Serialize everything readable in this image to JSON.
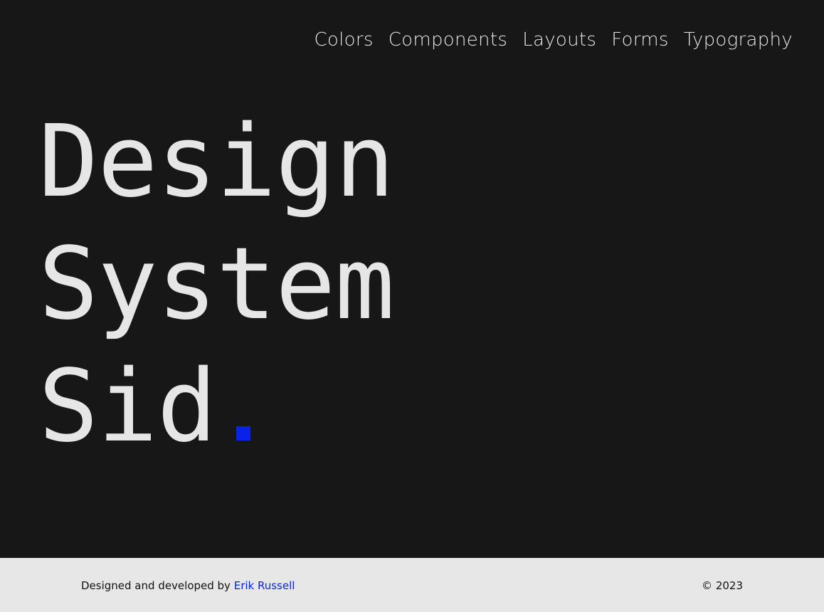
{
  "nav": {
    "items": [
      {
        "label": "Colors"
      },
      {
        "label": "Components"
      },
      {
        "label": "Layouts"
      },
      {
        "label": "Forms"
      },
      {
        "label": "Typography"
      }
    ]
  },
  "hero": {
    "line1": "Design",
    "line2": "System",
    "line3": "Sid",
    "dot_color": "#0a22e8"
  },
  "footer": {
    "credit_prefix": "Designed and developed by",
    "author_link": "Erik Russell",
    "copyright": "© 2023"
  },
  "colors": {
    "background": "#171717",
    "text": "#e6e6e6",
    "accent": "#0a22e8",
    "footer_background": "#e7e7e7"
  }
}
